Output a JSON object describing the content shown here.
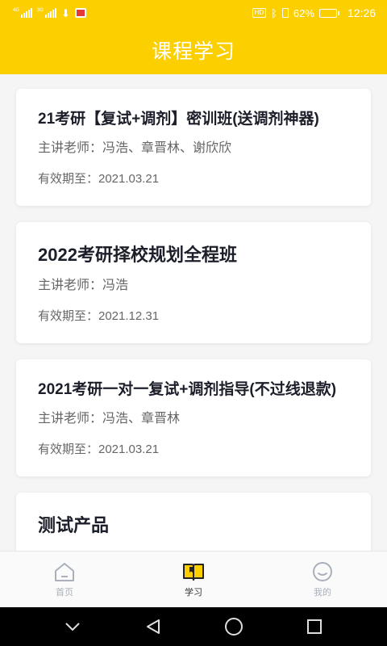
{
  "status_bar": {
    "signal1_label": "4G",
    "signal2_label": "3G",
    "hd_label": "HD",
    "battery_percent_text": "62%",
    "battery_level": 0.62,
    "time": "12:26"
  },
  "header": {
    "title": "课程学习"
  },
  "courses": [
    {
      "title": "21考研【复试+调剂】密训班(送调剂神器)",
      "teacher": "主讲老师：冯浩、章晋林、谢欣欣",
      "expiry": "有效期至：2021.03.21"
    },
    {
      "title": "2022考研择校规划全程班",
      "teacher": "主讲老师：冯浩",
      "expiry": "有效期至：2021.12.31"
    },
    {
      "title": "2021考研一对一复试+调剂指导(不过线退款)",
      "teacher": "主讲老师：冯浩、章晋林",
      "expiry": "有效期至：2021.03.21"
    },
    {
      "title": "测试产品",
      "teacher": "",
      "expiry": ""
    }
  ],
  "tabs": [
    {
      "label": "首页",
      "icon": "home-icon",
      "active": false
    },
    {
      "label": "学习",
      "icon": "book-icon",
      "active": true
    },
    {
      "label": "我的",
      "icon": "smile-icon",
      "active": false
    }
  ],
  "colors": {
    "brand": "#fcd000",
    "title_text": "#1c1f2a",
    "muted_text": "#666666",
    "tab_inactive": "#aab0bb"
  },
  "nav_icons": [
    "chevron-down-icon",
    "back-triangle-icon",
    "home-circle-icon",
    "recents-square-icon"
  ]
}
